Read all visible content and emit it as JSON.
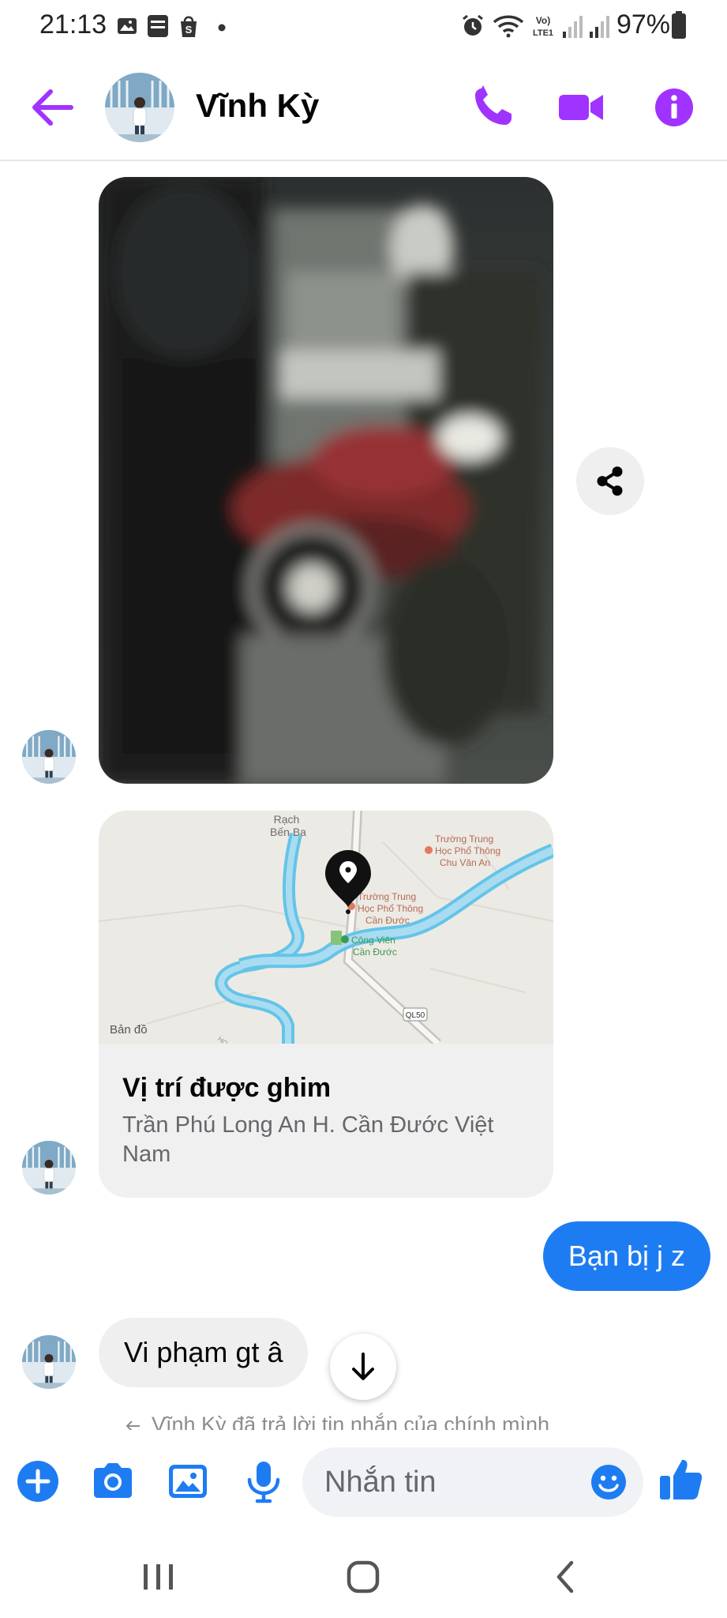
{
  "status_bar": {
    "time": "21:13",
    "notif_icons": [
      "gallery-icon",
      "baomoi-icon",
      "shopee-icon",
      "dot-icon"
    ],
    "system_icons": [
      "alarm-icon",
      "wifi-icon",
      "volte-icon",
      "signal-icon",
      "signal-icon"
    ],
    "volte_label": "Vo)\nLTE1",
    "battery": "97%"
  },
  "header": {
    "contact_name": "Vĩnh Kỳ",
    "accent_color": "#a033ff"
  },
  "chat": {
    "map": {
      "labels": {
        "river": "Rạch\nBến Ba",
        "school1_l1": "Trường Trung",
        "school1_l2": "Học Phổ Thông",
        "school1_l3": "Chu Văn An",
        "school2_l1": "Trường Trung",
        "school2_l2": "Học Phổ Thông",
        "school2_l3": "Cần Đước",
        "park_l1": "Công Viên",
        "park_l2": "Cần Đước",
        "road": "QL50",
        "provider": "Bản đồ",
        "street_partial": "HO VĂ"
      },
      "title": "Vị trí được ghim",
      "address": "Trần Phú Long An H. Cần Đước Việt Nam"
    },
    "outgoing_message": "Bạn bị j z",
    "incoming_message": "Vi phạm gt â",
    "reply_note": "Vĩnh Kỳ đã trả lời tin nhắn của chính mình",
    "bubble_out_color": "#1e7cf2"
  },
  "composer": {
    "placeholder": "Nhắn tin",
    "icon_color": "#1e7cf2"
  }
}
